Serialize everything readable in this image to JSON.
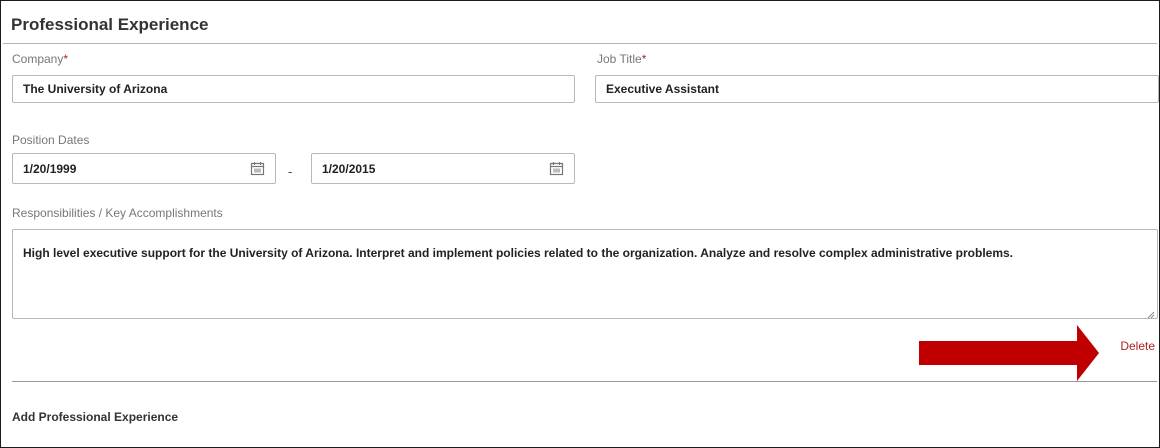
{
  "section": {
    "title": "Professional Experience"
  },
  "company": {
    "label": "Company",
    "required_mark": "*",
    "value": "The University of Arizona"
  },
  "job_title": {
    "label": "Job Title",
    "required_mark": "*",
    "value": "Executive Assistant"
  },
  "dates": {
    "label": "Position Dates",
    "start": "1/20/1999",
    "separator": "-",
    "end": "1/20/2015"
  },
  "responsibilities": {
    "label": "Responsibilities / Key Accomplishments",
    "value": "High level executive support for the University of Arizona. Interpret and implement policies related to the organization. Analyze and resolve complex administrative problems."
  },
  "actions": {
    "delete": "Delete",
    "add": "Add Professional Experience"
  },
  "colors": {
    "required": "#b12222",
    "delete_link": "#b12222",
    "annotation_arrow": "#c00000"
  },
  "icons": {
    "date_picker": "calendar-icon",
    "annotation": "arrow-right-icon",
    "textarea_grip": "resize-grip-icon"
  }
}
